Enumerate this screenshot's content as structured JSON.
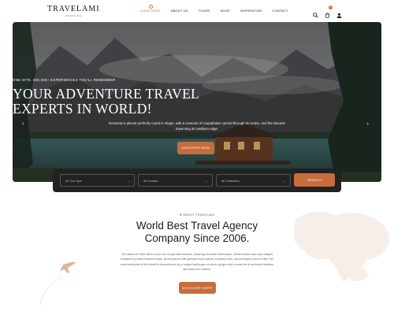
{
  "header": {
    "logo": "TRAVELAMI",
    "logo_tagline": "adventure Tour",
    "nav": [
      "HOME PAGE",
      "ABOUT US",
      "TOURS",
      "SHOP",
      "INSPIRATION",
      "CONTACT"
    ],
    "cart_count": "0",
    "icons": [
      "search-icon",
      "cart-icon",
      "user-icon"
    ]
  },
  "hero": {
    "kicker": "ONE SITE, 300,000+ EXPERIENCES YOU'LL REMEMBER",
    "title_line1": "YOUR ADVENTURE TRAVEL",
    "title_line2": "EXPERTS IN WORLD!",
    "description": "Romania is almost perfectly round in shape, with a crescent of Carpathians carved through its centre, and the Danube traversing its southern edge.",
    "button": "DISCOVER NOW",
    "prev_arrow": "‹",
    "next_arrow": "›"
  },
  "search": {
    "type_placeholder": "All Tour Type",
    "duration_placeholder": "All Duration",
    "destination_placeholder": "All Destination",
    "button": "SEARCH"
  },
  "about": {
    "kicker": "ABOUT TRAVELAMI",
    "title_line1": "World Best Travel Agency",
    "title_line2": "Company Since 2006.",
    "text": "The island of Crete offers a rare mix of splendid beaches, amazing mountain landscapes, vibrant towns and cosy villages inhabited by warm-hearted locals, all this spiced with genuine local cuisine, excellent wine, and perhaps a shot of raki! The south-west part of the island is characterized by a unique landscape of scenic gorges and a coast full of secluded beaches and deep blue waters.",
    "button": "DISCOVER MORE"
  },
  "colors": {
    "accent": "#c76d3b",
    "searchbar": "#222222"
  }
}
